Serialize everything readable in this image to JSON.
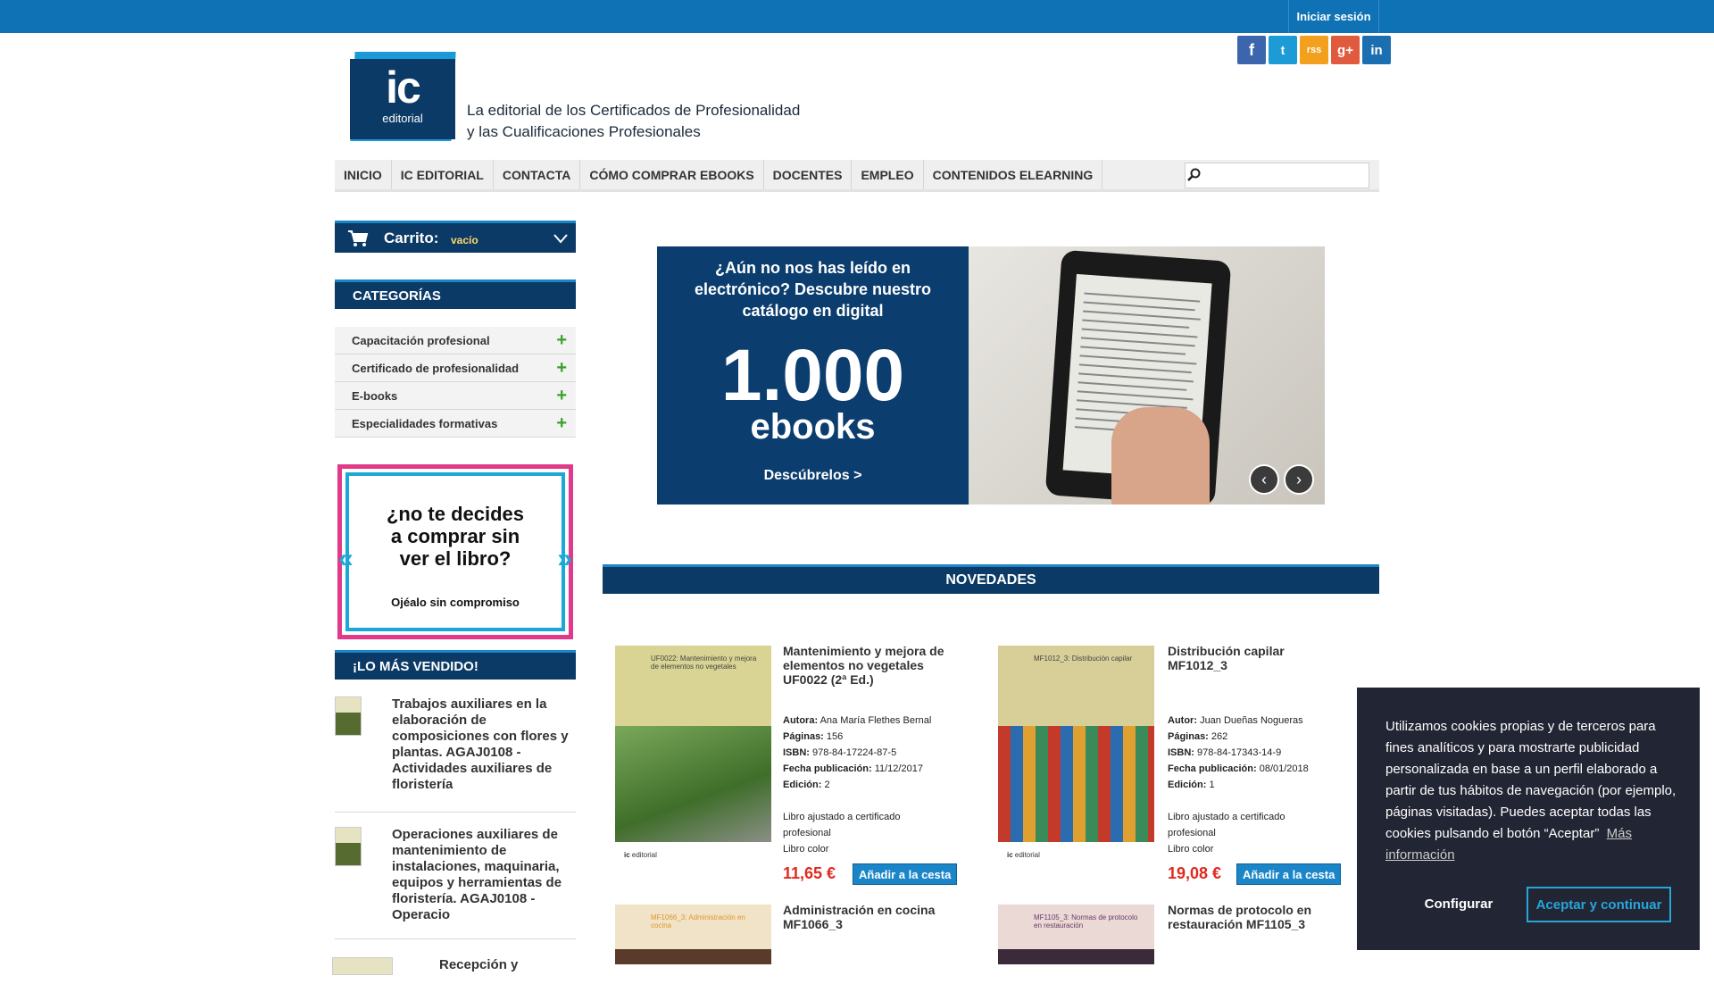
{
  "header": {
    "login": "Iniciar sesión",
    "logo_main": "ic",
    "logo_sub": "editorial",
    "tagline_1": "La editorial de los Certificados de Profesionalidad",
    "tagline_2": "y las Cualificaciones Profesionales",
    "social": {
      "facebook": "f",
      "twitter": "t",
      "rss": "rss",
      "google": "g+",
      "linkedin": "in"
    }
  },
  "nav": {
    "items": [
      "INICIO",
      "IC EDITORIAL",
      "CONTACTA",
      "CÓMO COMPRAR EBOOKS",
      "DOCENTES",
      "EMPLEO",
      "CONTENIDOS ELEARNING"
    ],
    "search_placeholder": ""
  },
  "sidebar": {
    "cart_label": "Carrito:",
    "cart_status": "vacío",
    "categories_title": "CATEGORÍAS",
    "categories": [
      "Capacitación profesional",
      "Certificado de profesionalidad",
      "E-books",
      "Especialidades formativas"
    ],
    "promo_line_1": "¿no te decides",
    "promo_line_2": "a comprar sin",
    "promo_line_3": "ver el libro?",
    "promo_cta": "Ojéalo sin compromiso",
    "bestsellers_title": "¡LO MÁS VENDIDO!",
    "bestsellers": [
      "Trabajos auxiliares en la elaboración de composiciones con flores y plantas. AGAJ0108 - Actividades auxiliares de floristería",
      "Operaciones auxiliares de mantenimiento de instalaciones, maquinaria, equipos y herramientas de floristería. AGAJ0108 - Operacio",
      "Recepción y"
    ]
  },
  "banner": {
    "headline": "¿Aún no nos has leído en electrónico? Descubre nuestro catálogo en digital",
    "number": "1.000",
    "unit": "ebooks",
    "cta": "Descúbrelos >"
  },
  "novedades": {
    "title": "NOVEDADES",
    "books": [
      {
        "cover_title": "UF0022: Mantenimiento y mejora de elementos no vegetales",
        "title": "Mantenimiento y mejora de elementos no vegetales UF0022 (2ª Ed.)",
        "autor_label": "Autora:",
        "autor": "Ana María Flethes Bernal",
        "paginas": "156",
        "isbn": "978-84-17224-87-5",
        "fecha": "11/12/2017",
        "edicion": "2",
        "nota1": "Libro ajustado a certificado profesional",
        "nota2": "Libro color",
        "price": "11,65 €",
        "accent": "#cbb84a"
      },
      {
        "cover_title": "MF1012_3: Distribución capilar",
        "title": "Distribución capilar MF1012_3",
        "autor_label": "Autor:",
        "autor": "Juan Dueñas Nogueras",
        "paginas": "262",
        "isbn": "978-84-17343-14-9",
        "fecha": "08/01/2018",
        "edicion": "1",
        "nota1": "Libro ajustado a certificado profesional",
        "nota2": "Libro color",
        "price": "19,08 €",
        "accent": "#c9b04a"
      },
      {
        "cover_title": "MF1066_3: Administración en cocina",
        "title": "Administración en cocina MF1066_3",
        "accent": "#e9a43a"
      },
      {
        "cover_title": "MF1105_3: Normas de protocolo en restauración",
        "title": "Normas de protocolo en restauración MF1105_3",
        "accent": "#6a3a6a"
      }
    ],
    "labels": {
      "paginas": "Páginas:",
      "isbn": "ISBN:",
      "fecha": "Fecha publicación:",
      "edicion": "Edición:",
      "add": "Añadir a la cesta"
    }
  },
  "cookie": {
    "text": "Utilizamos cookies propias y de terceros para fines analíticos y para mostrarte publicidad personalizada en base a un perfil elaborado a partir de tus hábitos de navegación (por ejemplo, páginas visitadas). Puedes aceptar todas las cookies pulsando el botón “Aceptar”",
    "more": "Más información",
    "config": "Configurar",
    "accept": "Aceptar y continuar"
  },
  "colors": {
    "brand_blue": "#0e72b5",
    "navy": "#0c3a66",
    "price_red": "#e1291e",
    "plus_green": "#3aa02a"
  }
}
